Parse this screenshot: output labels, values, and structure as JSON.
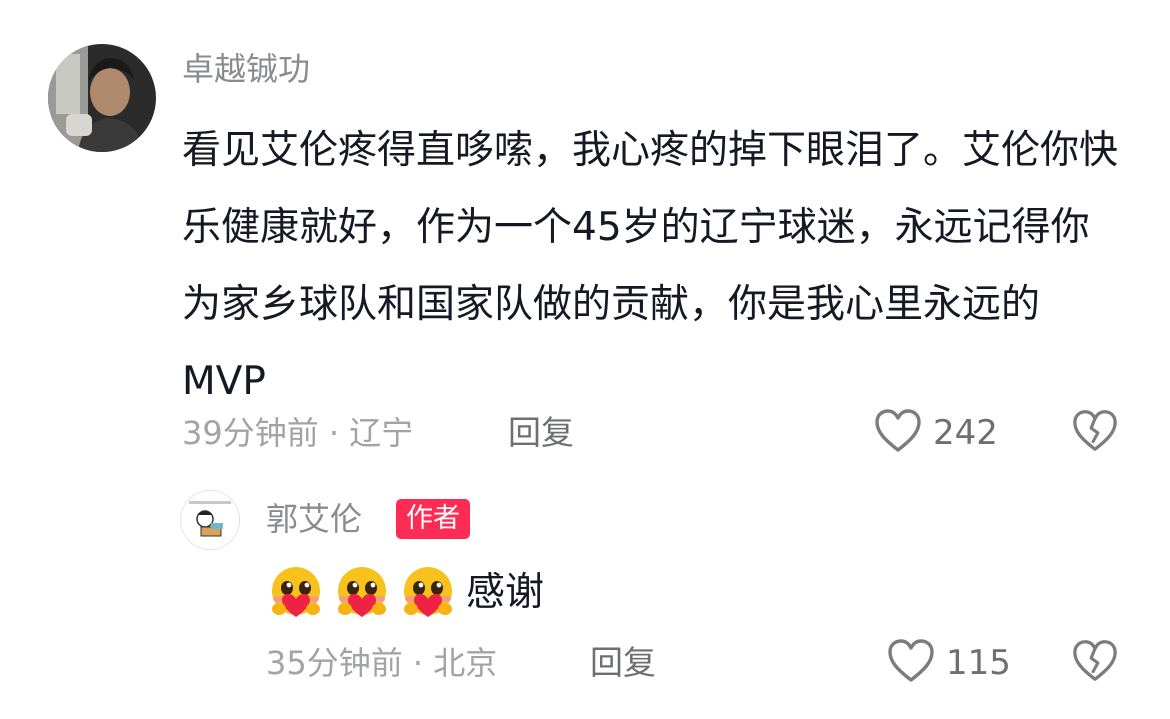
{
  "comment": {
    "username": "卓越铖功",
    "text": "看见艾伦疼得直哆嗦，我心疼的掉下眼泪了。艾伦你快乐健康就好，作为一个45岁的辽宁球迷，永远记得你为家乡球队和国家队做的贡献，你是我心里永远的MVP",
    "meta": "39分钟前 · 辽宁",
    "reply_label": "回复",
    "like_count": "242",
    "like_icon": "heart-outline-icon",
    "dislike_icon": "broken-heart-icon"
  },
  "reply": {
    "username": "郭艾伦",
    "badge": "作者",
    "emoji_name": "heart-hug-emoji",
    "emoji_count": 3,
    "text": "感谢",
    "meta": "35分钟前 · 北京",
    "reply_label": "回复",
    "like_count": "115"
  },
  "colors": {
    "text": "#161823",
    "muted": "#8a8b91",
    "badge": "#fe2c55"
  }
}
